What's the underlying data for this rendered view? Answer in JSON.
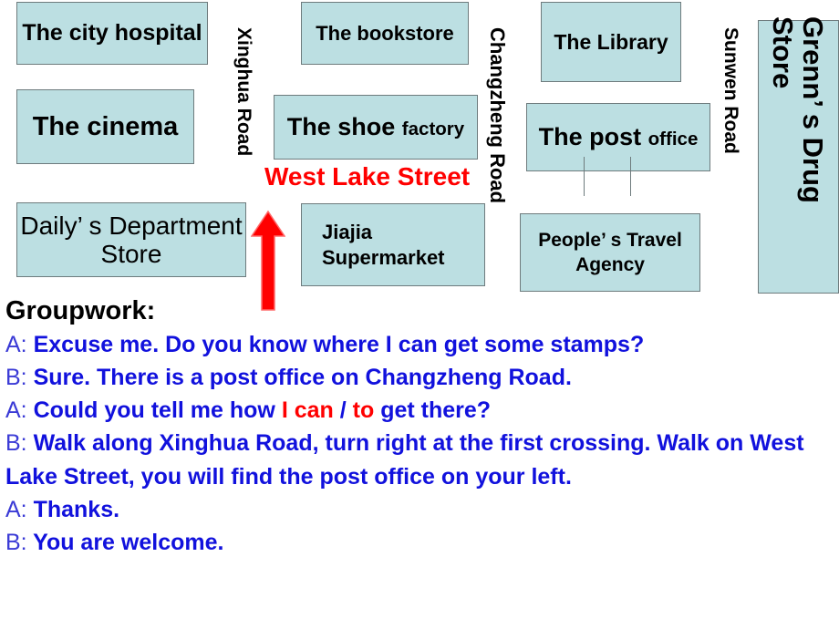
{
  "map": {
    "buildings": [
      {
        "id": "hospital",
        "label": "The city hospital"
      },
      {
        "id": "cinema",
        "label": "The cinema"
      },
      {
        "id": "daily",
        "label": "Daily’ s Department Store"
      },
      {
        "id": "bookstore",
        "label": "The bookstore"
      },
      {
        "id": "shoe",
        "label_main": "The shoe ",
        "label_small": "factory"
      },
      {
        "id": "jiajia",
        "label": "Jiajia Supermarket"
      },
      {
        "id": "library",
        "label": "The Library"
      },
      {
        "id": "post",
        "label_main": "The post ",
        "label_small": "office"
      },
      {
        "id": "people",
        "label": "People’ s Travel Agency"
      },
      {
        "id": "drug",
        "label": "Grenn’ s Drug Store"
      }
    ],
    "roads": [
      {
        "id": "xinghua",
        "label": "Xinghua Road",
        "orientation": "vertical"
      },
      {
        "id": "changzheng",
        "label": "Changzheng Road",
        "orientation": "vertical"
      },
      {
        "id": "sunwen",
        "label": "Sunwen Road",
        "orientation": "vertical"
      },
      {
        "id": "west-lake",
        "label": "West Lake Street",
        "orientation": "horizontal",
        "color": "#ff0000"
      }
    ],
    "arrow": {
      "name": "red-up-arrow",
      "color": "#ff0000",
      "direction": "up"
    },
    "colors": {
      "building_fill": "#bcdfe2",
      "building_border": "#6e7b7d",
      "street_highlight": "#ff0000"
    }
  },
  "dialogue": {
    "heading": "Groupwork:",
    "lines": [
      {
        "speaker": "A:",
        "pre": " Excuse me. Do you know where I can get some stamps?"
      },
      {
        "speaker": "B:",
        "pre": " Sure. There is a post office on Changzheng Road."
      },
      {
        "speaker": "A:",
        "pre": " Could you tell me how ",
        "hl1": "I can",
        "mid": " / ",
        "hl2": "to",
        "post": " get there?"
      },
      {
        "speaker": "B:",
        "pre": " Walk along Xinghua Road, turn right at the first crossing. Walk on West Lake Street, you will find the post office on your left."
      },
      {
        "speaker": "A:",
        "pre": " Thanks."
      },
      {
        "speaker": "B:",
        "pre": " You are welcome."
      }
    ],
    "colors": {
      "text": "#1111dd",
      "speaker": "#3b3bd6",
      "highlight": "#ff0000",
      "heading": "#000000"
    }
  }
}
